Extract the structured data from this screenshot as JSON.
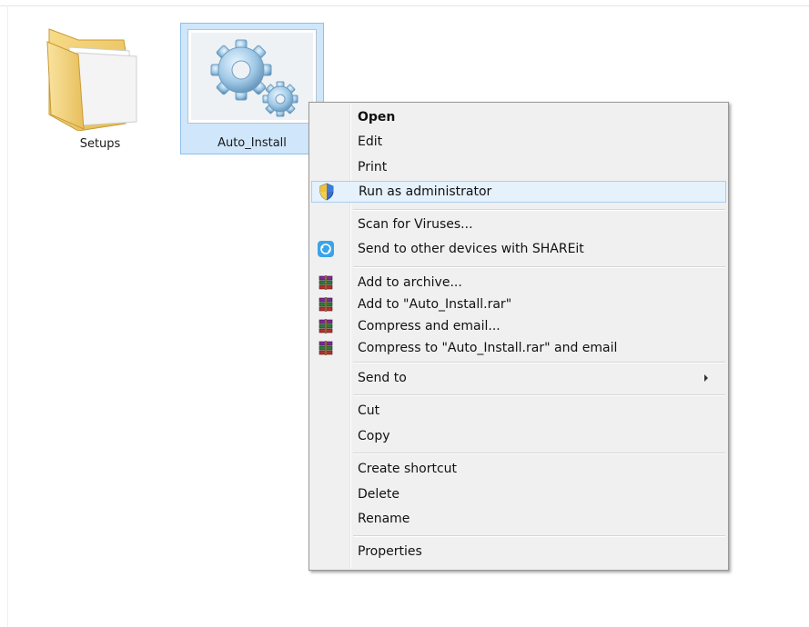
{
  "files": [
    {
      "name": "Setups",
      "icon": "folder-icon"
    },
    {
      "name": "Auto_Install",
      "icon": "gears-icon",
      "selected": true
    }
  ],
  "menu": {
    "open": "Open",
    "edit": "Edit",
    "print": "Print",
    "run_as_admin": "Run as administrator",
    "scan": "Scan for Viruses...",
    "shareit": "Send to other devices with SHAREit",
    "add_archive": "Add to archive...",
    "add_rar": "Add to \"Auto_Install.rar\"",
    "compress_email": "Compress and email...",
    "compress_rar_email": "Compress to \"Auto_Install.rar\" and email",
    "send_to": "Send to",
    "cut": "Cut",
    "copy": "Copy",
    "create_shortcut": "Create shortcut",
    "delete": "Delete",
    "rename": "Rename",
    "properties": "Properties"
  },
  "colors": {
    "selection_bg": "#cfe6fb",
    "selection_border": "#8cc0ee",
    "menu_bg": "#f0f0f0",
    "highlight_bg": "#e5f1fb",
    "highlight_border": "#a9cef0"
  }
}
